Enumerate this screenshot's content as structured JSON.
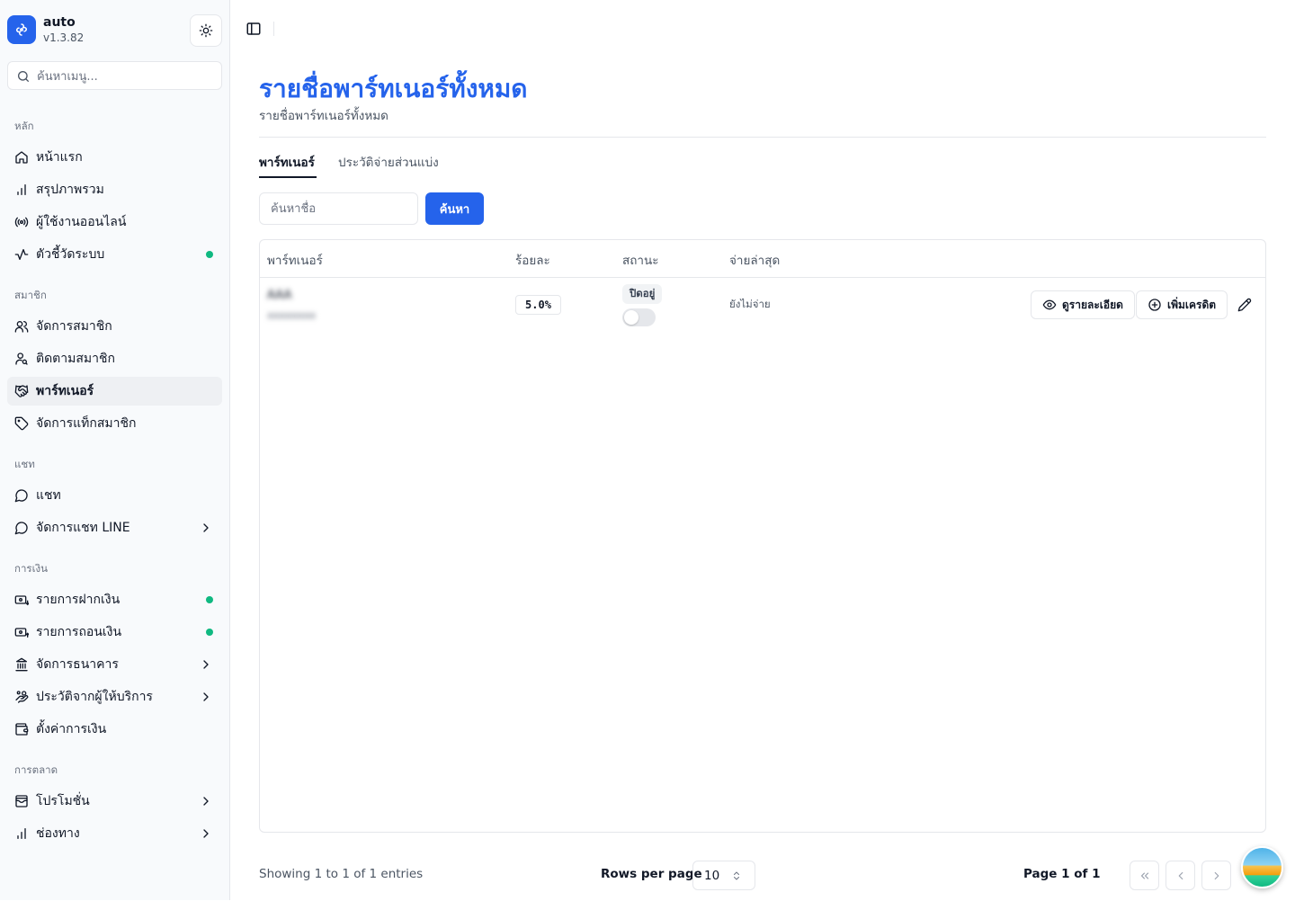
{
  "app": {
    "name": "auto",
    "version": "v1.3.82"
  },
  "sidebar": {
    "search_placeholder": "ค้นหาเมนู...",
    "sections": {
      "main": "หลัก",
      "members": "สมาชิก",
      "chat": "แชท",
      "finance": "การเงิน",
      "marketing": "การตลาด"
    },
    "items": [
      {
        "label": "หน้าแรก",
        "icon": "home-icon"
      },
      {
        "label": "สรุปภาพรวม",
        "icon": "bar-chart-icon"
      },
      {
        "label": "ผู้ใช้งานออนไลน์",
        "icon": "radio-icon"
      },
      {
        "label": "ตัวชี้วัดระบบ",
        "icon": "activity-icon",
        "dot": true
      },
      {
        "label": "จัดการสมาชิก",
        "icon": "users-icon"
      },
      {
        "label": "ติดตามสมาชิก",
        "icon": "user-search-icon"
      },
      {
        "label": "พาร์ทเนอร์",
        "icon": "handshake-icon",
        "active": true
      },
      {
        "label": "จัดการแท็กสมาชิก",
        "icon": "tag-icon"
      },
      {
        "label": "แชท",
        "icon": "message-circle-icon"
      },
      {
        "label": "จัดการแชท LINE",
        "icon": "message-circle-icon",
        "chevron": true
      },
      {
        "label": "รายการฝากเงิน",
        "icon": "deposit-icon",
        "dot": true
      },
      {
        "label": "รายการถอนเงิน",
        "icon": "withdraw-icon",
        "dot": true
      },
      {
        "label": "จัดการธนาคาร",
        "icon": "bank-icon",
        "chevron": true
      },
      {
        "label": "ประวัติจากผู้ให้บริการ",
        "icon": "hand-coins-icon",
        "chevron": true
      },
      {
        "label": "ตั้งค่าการเงิน",
        "icon": "wallet-icon"
      },
      {
        "label": "โปรโมชั่น",
        "icon": "wallet-cards-icon",
        "chevron": true
      },
      {
        "label": "ช่องทาง",
        "icon": "bar-chart-icon",
        "chevron": true
      }
    ],
    "status_dot_color": "#10b981"
  },
  "page": {
    "title": "รายชื่อพาร์ทเนอร์ทั้งหมด",
    "subtitle": "รายชื่อพาร์ทเนอร์ทั้งหมด",
    "tabs": [
      {
        "label": "พาร์ทเนอร์",
        "active": true
      },
      {
        "label": "ประวัติจ่ายส่วนแบ่ง",
        "active": false
      }
    ],
    "search": {
      "placeholder": "ค้นหาชื่อ",
      "value": "",
      "button_label": "ค้นหา"
    },
    "accent_color": "#2563eb"
  },
  "table": {
    "columns": [
      "พาร์ทเนอร์",
      "ร้อยละ",
      "สถานะ",
      "จ่ายล่าสุด"
    ],
    "rows": [
      {
        "partner_name": "AAA",
        "partner_sub": "aaaaaaaa",
        "percent": "5.0%",
        "status": "ปิดอยู่",
        "enabled": false,
        "last_paid": "ยังไม่จ่าย",
        "view_label": "ดูรายละเอียด",
        "add_credit_label": "เพิ่มเครดิต"
      }
    ]
  },
  "pagination": {
    "entries_text": "Showing 1 to 1 of 1 entries",
    "rows_per_page_label": "Rows per page",
    "rows_per_page_value": "10",
    "page_text": "Page 1 of 1"
  }
}
